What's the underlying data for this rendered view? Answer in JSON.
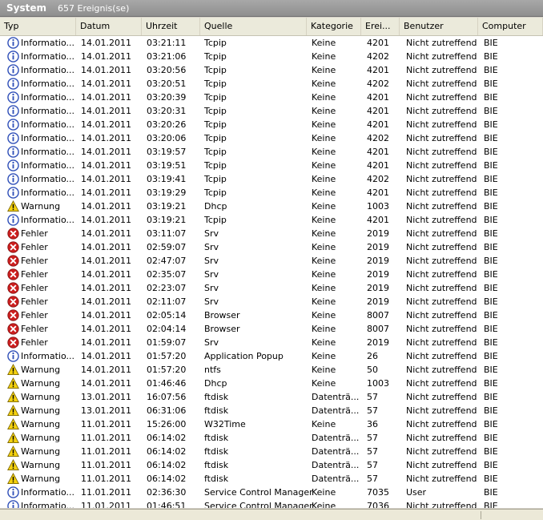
{
  "title": "System",
  "event_count": "657 Ereignis(se)",
  "columns": [
    "Typ",
    "Datum",
    "Uhrzeit",
    "Quelle",
    "Kategorie",
    "Erei...",
    "Benutzer",
    "Computer"
  ],
  "rows": [
    {
      "icon": "info-icon",
      "type": "Informatio...",
      "date": "14.01.2011",
      "time": "03:21:11",
      "source": "Tcpip",
      "category": "Keine",
      "event": "4201",
      "user": "Nicht zutreffend",
      "computer": "BIE"
    },
    {
      "icon": "info-icon",
      "type": "Informatio...",
      "date": "14.01.2011",
      "time": "03:21:06",
      "source": "Tcpip",
      "category": "Keine",
      "event": "4202",
      "user": "Nicht zutreffend",
      "computer": "BIE"
    },
    {
      "icon": "info-icon",
      "type": "Informatio...",
      "date": "14.01.2011",
      "time": "03:20:56",
      "source": "Tcpip",
      "category": "Keine",
      "event": "4201",
      "user": "Nicht zutreffend",
      "computer": "BIE"
    },
    {
      "icon": "info-icon",
      "type": "Informatio...",
      "date": "14.01.2011",
      "time": "03:20:51",
      "source": "Tcpip",
      "category": "Keine",
      "event": "4202",
      "user": "Nicht zutreffend",
      "computer": "BIE"
    },
    {
      "icon": "info-icon",
      "type": "Informatio...",
      "date": "14.01.2011",
      "time": "03:20:39",
      "source": "Tcpip",
      "category": "Keine",
      "event": "4201",
      "user": "Nicht zutreffend",
      "computer": "BIE"
    },
    {
      "icon": "info-icon",
      "type": "Informatio...",
      "date": "14.01.2011",
      "time": "03:20:31",
      "source": "Tcpip",
      "category": "Keine",
      "event": "4201",
      "user": "Nicht zutreffend",
      "computer": "BIE"
    },
    {
      "icon": "info-icon",
      "type": "Informatio...",
      "date": "14.01.2011",
      "time": "03:20:26",
      "source": "Tcpip",
      "category": "Keine",
      "event": "4201",
      "user": "Nicht zutreffend",
      "computer": "BIE"
    },
    {
      "icon": "info-icon",
      "type": "Informatio...",
      "date": "14.01.2011",
      "time": "03:20:06",
      "source": "Tcpip",
      "category": "Keine",
      "event": "4202",
      "user": "Nicht zutreffend",
      "computer": "BIE"
    },
    {
      "icon": "info-icon",
      "type": "Informatio...",
      "date": "14.01.2011",
      "time": "03:19:57",
      "source": "Tcpip",
      "category": "Keine",
      "event": "4201",
      "user": "Nicht zutreffend",
      "computer": "BIE"
    },
    {
      "icon": "info-icon",
      "type": "Informatio...",
      "date": "14.01.2011",
      "time": "03:19:51",
      "source": "Tcpip",
      "category": "Keine",
      "event": "4201",
      "user": "Nicht zutreffend",
      "computer": "BIE"
    },
    {
      "icon": "info-icon",
      "type": "Informatio...",
      "date": "14.01.2011",
      "time": "03:19:41",
      "source": "Tcpip",
      "category": "Keine",
      "event": "4202",
      "user": "Nicht zutreffend",
      "computer": "BIE"
    },
    {
      "icon": "info-icon",
      "type": "Informatio...",
      "date": "14.01.2011",
      "time": "03:19:29",
      "source": "Tcpip",
      "category": "Keine",
      "event": "4201",
      "user": "Nicht zutreffend",
      "computer": "BIE"
    },
    {
      "icon": "warning-icon",
      "type": "Warnung",
      "date": "14.01.2011",
      "time": "03:19:21",
      "source": "Dhcp",
      "category": "Keine",
      "event": "1003",
      "user": "Nicht zutreffend",
      "computer": "BIE"
    },
    {
      "icon": "info-icon",
      "type": "Informatio...",
      "date": "14.01.2011",
      "time": "03:19:21",
      "source": "Tcpip",
      "category": "Keine",
      "event": "4201",
      "user": "Nicht zutreffend",
      "computer": "BIE"
    },
    {
      "icon": "error-icon",
      "type": "Fehler",
      "date": "14.01.2011",
      "time": "03:11:07",
      "source": "Srv",
      "category": "Keine",
      "event": "2019",
      "user": "Nicht zutreffend",
      "computer": "BIE"
    },
    {
      "icon": "error-icon",
      "type": "Fehler",
      "date": "14.01.2011",
      "time": "02:59:07",
      "source": "Srv",
      "category": "Keine",
      "event": "2019",
      "user": "Nicht zutreffend",
      "computer": "BIE"
    },
    {
      "icon": "error-icon",
      "type": "Fehler",
      "date": "14.01.2011",
      "time": "02:47:07",
      "source": "Srv",
      "category": "Keine",
      "event": "2019",
      "user": "Nicht zutreffend",
      "computer": "BIE"
    },
    {
      "icon": "error-icon",
      "type": "Fehler",
      "date": "14.01.2011",
      "time": "02:35:07",
      "source": "Srv",
      "category": "Keine",
      "event": "2019",
      "user": "Nicht zutreffend",
      "computer": "BIE"
    },
    {
      "icon": "error-icon",
      "type": "Fehler",
      "date": "14.01.2011",
      "time": "02:23:07",
      "source": "Srv",
      "category": "Keine",
      "event": "2019",
      "user": "Nicht zutreffend",
      "computer": "BIE"
    },
    {
      "icon": "error-icon",
      "type": "Fehler",
      "date": "14.01.2011",
      "time": "02:11:07",
      "source": "Srv",
      "category": "Keine",
      "event": "2019",
      "user": "Nicht zutreffend",
      "computer": "BIE"
    },
    {
      "icon": "error-icon",
      "type": "Fehler",
      "date": "14.01.2011",
      "time": "02:05:14",
      "source": "Browser",
      "category": "Keine",
      "event": "8007",
      "user": "Nicht zutreffend",
      "computer": "BIE"
    },
    {
      "icon": "error-icon",
      "type": "Fehler",
      "date": "14.01.2011",
      "time": "02:04:14",
      "source": "Browser",
      "category": "Keine",
      "event": "8007",
      "user": "Nicht zutreffend",
      "computer": "BIE"
    },
    {
      "icon": "error-icon",
      "type": "Fehler",
      "date": "14.01.2011",
      "time": "01:59:07",
      "source": "Srv",
      "category": "Keine",
      "event": "2019",
      "user": "Nicht zutreffend",
      "computer": "BIE"
    },
    {
      "icon": "info-icon",
      "type": "Informatio...",
      "date": "14.01.2011",
      "time": "01:57:20",
      "source": "Application Popup",
      "category": "Keine",
      "event": "26",
      "user": "Nicht zutreffend",
      "computer": "BIE"
    },
    {
      "icon": "warning-icon",
      "type": "Warnung",
      "date": "14.01.2011",
      "time": "01:57:20",
      "source": "ntfs",
      "category": "Keine",
      "event": "50",
      "user": "Nicht zutreffend",
      "computer": "BIE"
    },
    {
      "icon": "warning-icon",
      "type": "Warnung",
      "date": "14.01.2011",
      "time": "01:46:46",
      "source": "Dhcp",
      "category": "Keine",
      "event": "1003",
      "user": "Nicht zutreffend",
      "computer": "BIE"
    },
    {
      "icon": "warning-icon",
      "type": "Warnung",
      "date": "13.01.2011",
      "time": "16:07:56",
      "source": "ftdisk",
      "category": "Datenträ...",
      "event": "57",
      "user": "Nicht zutreffend",
      "computer": "BIE"
    },
    {
      "icon": "warning-icon",
      "type": "Warnung",
      "date": "13.01.2011",
      "time": "06:31:06",
      "source": "ftdisk",
      "category": "Datenträ...",
      "event": "57",
      "user": "Nicht zutreffend",
      "computer": "BIE"
    },
    {
      "icon": "warning-icon",
      "type": "Warnung",
      "date": "11.01.2011",
      "time": "15:26:00",
      "source": "W32Time",
      "category": "Keine",
      "event": "36",
      "user": "Nicht zutreffend",
      "computer": "BIE"
    },
    {
      "icon": "warning-icon",
      "type": "Warnung",
      "date": "11.01.2011",
      "time": "06:14:02",
      "source": "ftdisk",
      "category": "Datenträ...",
      "event": "57",
      "user": "Nicht zutreffend",
      "computer": "BIE"
    },
    {
      "icon": "warning-icon",
      "type": "Warnung",
      "date": "11.01.2011",
      "time": "06:14:02",
      "source": "ftdisk",
      "category": "Datenträ...",
      "event": "57",
      "user": "Nicht zutreffend",
      "computer": "BIE"
    },
    {
      "icon": "warning-icon",
      "type": "Warnung",
      "date": "11.01.2011",
      "time": "06:14:02",
      "source": "ftdisk",
      "category": "Datenträ...",
      "event": "57",
      "user": "Nicht zutreffend",
      "computer": "BIE"
    },
    {
      "icon": "warning-icon",
      "type": "Warnung",
      "date": "11.01.2011",
      "time": "06:14:02",
      "source": "ftdisk",
      "category": "Datenträ...",
      "event": "57",
      "user": "Nicht zutreffend",
      "computer": "BIE"
    },
    {
      "icon": "info-icon",
      "type": "Informatio...",
      "date": "11.01.2011",
      "time": "02:36:30",
      "source": "Service Control Manager",
      "category": "Keine",
      "event": "7035",
      "user": "User",
      "computer": "BIE"
    },
    {
      "icon": "info-icon",
      "type": "Informatio...",
      "date": "11.01.2011",
      "time": "01:46:51",
      "source": "Service Control Manager",
      "category": "Keine",
      "event": "7036",
      "user": "Nicht zutreffend",
      "computer": "BIE"
    }
  ],
  "colors": {
    "info": "#2f4fb8",
    "warning": "#f5d20f",
    "error": "#cc1f1f",
    "header_bg": "#ebeadb",
    "title_bg": "#9c9c9c"
  }
}
